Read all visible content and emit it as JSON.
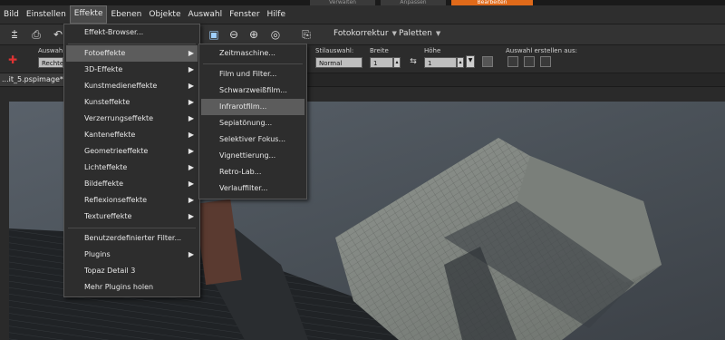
{
  "workspace_tabs": [
    "Verwalten",
    "Anpassen",
    "Bearbeiten"
  ],
  "menubar": {
    "items": [
      {
        "label": "Bild"
      },
      {
        "label": "Einstellen"
      },
      {
        "label": "Effekte"
      },
      {
        "label": "Ebenen"
      },
      {
        "label": "Objekte"
      },
      {
        "label": "Auswahl"
      },
      {
        "label": "Fenster"
      },
      {
        "label": "Hilfe"
      }
    ]
  },
  "toolbar": {
    "fotokorrektur": "Fotokorrektur",
    "paletten": "Paletten"
  },
  "options": {
    "auswahl": "Auswahl",
    "rechteck": "Rechteck",
    "stilauswahl_label": "Stilauswahl:",
    "stilauswahl_value": "Normal",
    "breite_label": "Breite",
    "breite_value": "1",
    "hoehe_label": "Höhe",
    "hoehe_value": "1",
    "auswahl_erstellen_label": "Auswahl erstellen aus:"
  },
  "document": {
    "tab_label": "...it_5.pspimage*"
  },
  "effekte_menu": {
    "items": [
      {
        "label": "Effekt-Browser...",
        "submenu": false
      },
      {
        "label": "Fotoeffekte",
        "submenu": true
      },
      {
        "label": "3D-Effekte",
        "submenu": true
      },
      {
        "label": "Kunstmedieneffekte",
        "submenu": true
      },
      {
        "label": "Kunsteffekte",
        "submenu": true
      },
      {
        "label": "Verzerrungseffekte",
        "submenu": true
      },
      {
        "label": "Kanteneffekte",
        "submenu": true
      },
      {
        "label": "Geometrieeffekte",
        "submenu": true
      },
      {
        "label": "Lichteffekte",
        "submenu": true
      },
      {
        "label": "Bildeffekte",
        "submenu": true
      },
      {
        "label": "Reflexionseffekte",
        "submenu": true
      },
      {
        "label": "Textureffekte",
        "submenu": true
      },
      {
        "label": "Benutzerdefinierter Filter...",
        "submenu": false
      },
      {
        "label": "Plugins",
        "submenu": true
      },
      {
        "label": "Topaz Detail 3",
        "submenu": false
      },
      {
        "label": "Mehr Plugins holen",
        "submenu": false
      }
    ]
  },
  "fotoeffekte_menu": {
    "items": [
      {
        "label": "Zeitmaschine..."
      },
      {
        "label": "Film und Filter..."
      },
      {
        "label": "Schwarzweißfilm..."
      },
      {
        "label": "Infrarotfilm..."
      },
      {
        "label": "Sepiatönung..."
      },
      {
        "label": "Selektiver Fokus..."
      },
      {
        "label": "Vignettierung..."
      },
      {
        "label": "Retro-Lab..."
      },
      {
        "label": "Verlauffilter..."
      }
    ]
  }
}
